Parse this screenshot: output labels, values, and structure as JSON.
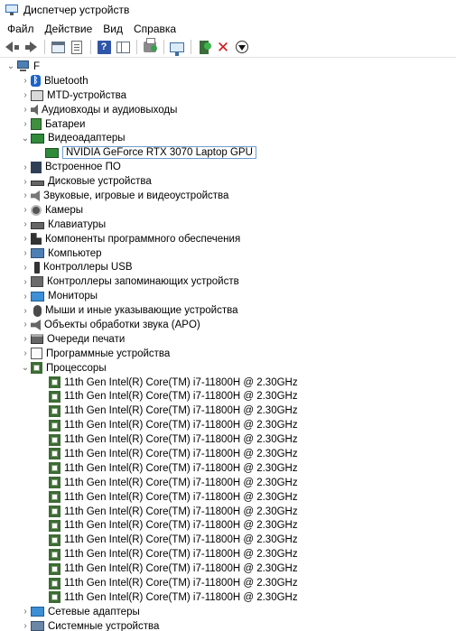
{
  "window": {
    "title": "Диспетчер устройств"
  },
  "menu": [
    "Файл",
    "Действие",
    "Вид",
    "Справка"
  ],
  "toolbar": {
    "buttons": [
      "back-icon",
      "forward-icon",
      "show-hide-console-tree-icon",
      "properties-icon",
      "help-icon",
      "action-pane-icon",
      "update-driver-icon",
      "scan-hardware-icon",
      "add-driver-icon",
      "uninstall-device-icon",
      "disable-device-icon"
    ]
  },
  "tree": {
    "root": {
      "label": "F",
      "expanded": true
    },
    "categories": [
      {
        "label": "Bluetooth",
        "icon": "bluetooth-icon",
        "expanded": false
      },
      {
        "label": "MTD-устройства",
        "icon": "mtd-icon",
        "expanded": false
      },
      {
        "label": "Аудиовходы и аудиовыходы",
        "icon": "audio-icon",
        "expanded": false
      },
      {
        "label": "Батареи",
        "icon": "battery-icon",
        "expanded": false
      },
      {
        "label": "Видеоадаптеры",
        "icon": "display-adapter-icon",
        "expanded": true,
        "children": [
          {
            "label": "NVIDIA GeForce RTX 3070 Laptop GPU",
            "icon": "gpu-icon",
            "selected": true
          }
        ]
      },
      {
        "label": "Встроенное ПО",
        "icon": "firmware-icon",
        "expanded": false
      },
      {
        "label": "Дисковые устройства",
        "icon": "disk-icon",
        "expanded": false
      },
      {
        "label": "Звуковые, игровые и видеоустройства",
        "icon": "sound-icon",
        "expanded": false
      },
      {
        "label": "Камеры",
        "icon": "camera-icon",
        "expanded": false
      },
      {
        "label": "Клавиатуры",
        "icon": "keyboard-icon",
        "expanded": false
      },
      {
        "label": "Компоненты программного обеспечения",
        "icon": "software-component-icon",
        "expanded": false
      },
      {
        "label": "Компьютер",
        "icon": "computer-icon",
        "expanded": false
      },
      {
        "label": "Контроллеры USB",
        "icon": "usb-icon",
        "expanded": false
      },
      {
        "label": "Контроллеры запоминающих устройств",
        "icon": "storage-controller-icon",
        "expanded": false
      },
      {
        "label": "Мониторы",
        "icon": "monitor-icon",
        "expanded": false
      },
      {
        "label": "Мыши и иные указывающие устройства",
        "icon": "mouse-icon",
        "expanded": false
      },
      {
        "label": "Объекты обработки звука (APO)",
        "icon": "apo-icon",
        "expanded": false
      },
      {
        "label": "Очереди печати",
        "icon": "print-queue-icon",
        "expanded": false
      },
      {
        "label": "Программные устройства",
        "icon": "software-device-icon",
        "expanded": false
      },
      {
        "label": "Процессоры",
        "icon": "processor-icon",
        "expanded": true,
        "children": [
          {
            "label": "11th Gen Intel(R) Core(TM) i7-11800H @ 2.30GHz"
          },
          {
            "label": "11th Gen Intel(R) Core(TM) i7-11800H @ 2.30GHz"
          },
          {
            "label": "11th Gen Intel(R) Core(TM) i7-11800H @ 2.30GHz"
          },
          {
            "label": "11th Gen Intel(R) Core(TM) i7-11800H @ 2.30GHz"
          },
          {
            "label": "11th Gen Intel(R) Core(TM) i7-11800H @ 2.30GHz"
          },
          {
            "label": "11th Gen Intel(R) Core(TM) i7-11800H @ 2.30GHz"
          },
          {
            "label": "11th Gen Intel(R) Core(TM) i7-11800H @ 2.30GHz"
          },
          {
            "label": "11th Gen Intel(R) Core(TM) i7-11800H @ 2.30GHz"
          },
          {
            "label": "11th Gen Intel(R) Core(TM) i7-11800H @ 2.30GHz"
          },
          {
            "label": "11th Gen Intel(R) Core(TM) i7-11800H @ 2.30GHz"
          },
          {
            "label": "11th Gen Intel(R) Core(TM) i7-11800H @ 2.30GHz"
          },
          {
            "label": "11th Gen Intel(R) Core(TM) i7-11800H @ 2.30GHz"
          },
          {
            "label": "11th Gen Intel(R) Core(TM) i7-11800H @ 2.30GHz"
          },
          {
            "label": "11th Gen Intel(R) Core(TM) i7-11800H @ 2.30GHz"
          },
          {
            "label": "11th Gen Intel(R) Core(TM) i7-11800H @ 2.30GHz"
          },
          {
            "label": "11th Gen Intel(R) Core(TM) i7-11800H @ 2.30GHz"
          }
        ]
      },
      {
        "label": "Сетевые адаптеры",
        "icon": "network-adapter-icon",
        "expanded": false
      },
      {
        "label": "Системные устройства",
        "icon": "system-device-icon",
        "expanded": false
      }
    ]
  }
}
